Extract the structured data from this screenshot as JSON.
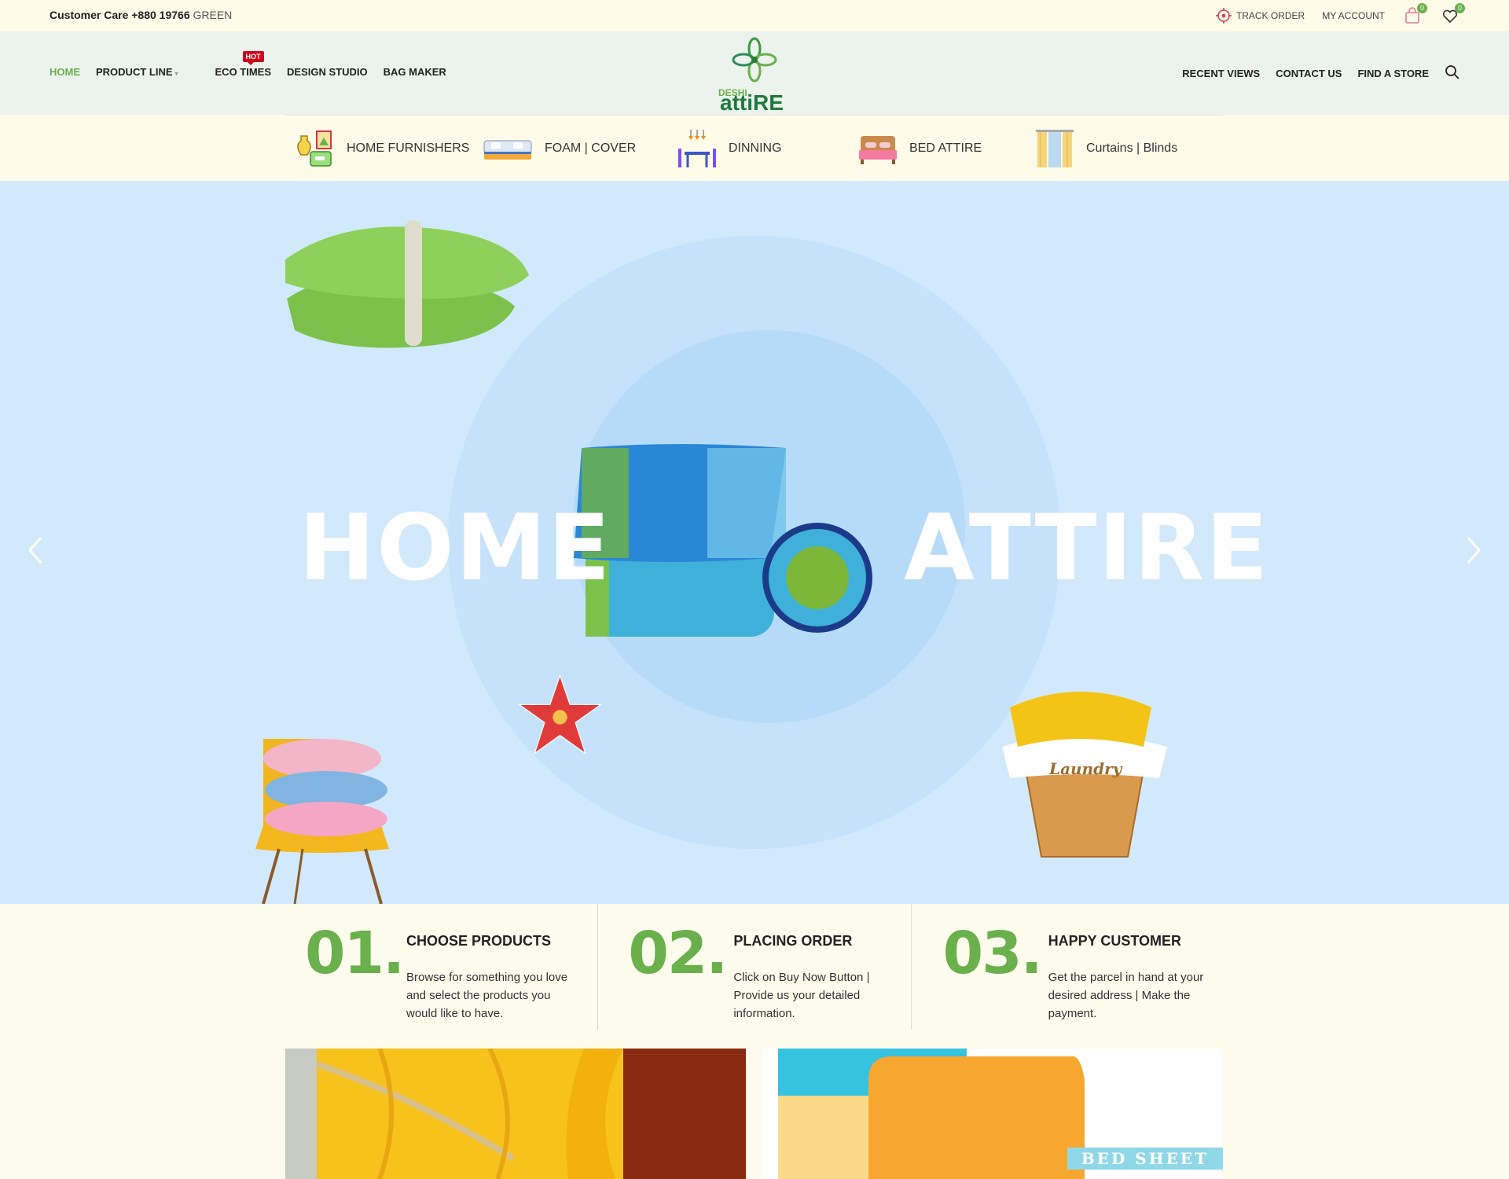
{
  "topbar": {
    "customer_care": "Customer Care +880 19766",
    "customer_care_hl": "GREEN",
    "track_order": "TRACK ORDER",
    "my_account": "MY ACCOUNT",
    "cart_count": "0",
    "wishlist_count": "0"
  },
  "nav_left": [
    {
      "label": "HOME"
    },
    {
      "label": "PRODUCT LINE"
    },
    {
      "label": "ECO TIMES"
    },
    {
      "label": "DESIGN STUDIO"
    },
    {
      "label": "BAG MAKER"
    }
  ],
  "hot_badge": "HOT",
  "nav_right": [
    {
      "label": "RECENT VIEWS"
    },
    {
      "label": "CONTACT US"
    },
    {
      "label": "FIND A STORE"
    }
  ],
  "logo": {
    "line1": "DESHI",
    "line2": "attiRE"
  },
  "categories": [
    {
      "label": "HOME FURNISHERS",
      "icon": "vase-frame-icon"
    },
    {
      "label": "FOAM | COVER",
      "icon": "sofa-icon"
    },
    {
      "label": "DINNING",
      "icon": "dining-table-icon"
    },
    {
      "label": "BED ATTIRE",
      "icon": "bed-icon"
    },
    {
      "label": "Curtains | Blinds",
      "icon": "curtain-icon"
    }
  ],
  "hero": {
    "word_left": "HOME",
    "word_right": "ATTIRE",
    "laundry_text": "Laundry"
  },
  "steps": [
    {
      "num": "01.",
      "title": "CHOOSE PRODUCTS",
      "desc": "Browse for something you love and select the products you would like to have."
    },
    {
      "num": "02.",
      "title": "PLACING ORDER",
      "desc": "Click on Buy Now Button | Provide us your detailed information."
    },
    {
      "num": "03.",
      "title": "HAPPY CUSTOMER",
      "desc": "Get the parcel in hand at your desired address | Make the payment."
    }
  ],
  "promo": {
    "right_label": "BED SHEET"
  },
  "colors": {
    "brand_green": "#6ab04c",
    "hero_bg": "#d2e9fb",
    "cream": "#fefbe8",
    "header_bg": "#ebf3ec"
  }
}
